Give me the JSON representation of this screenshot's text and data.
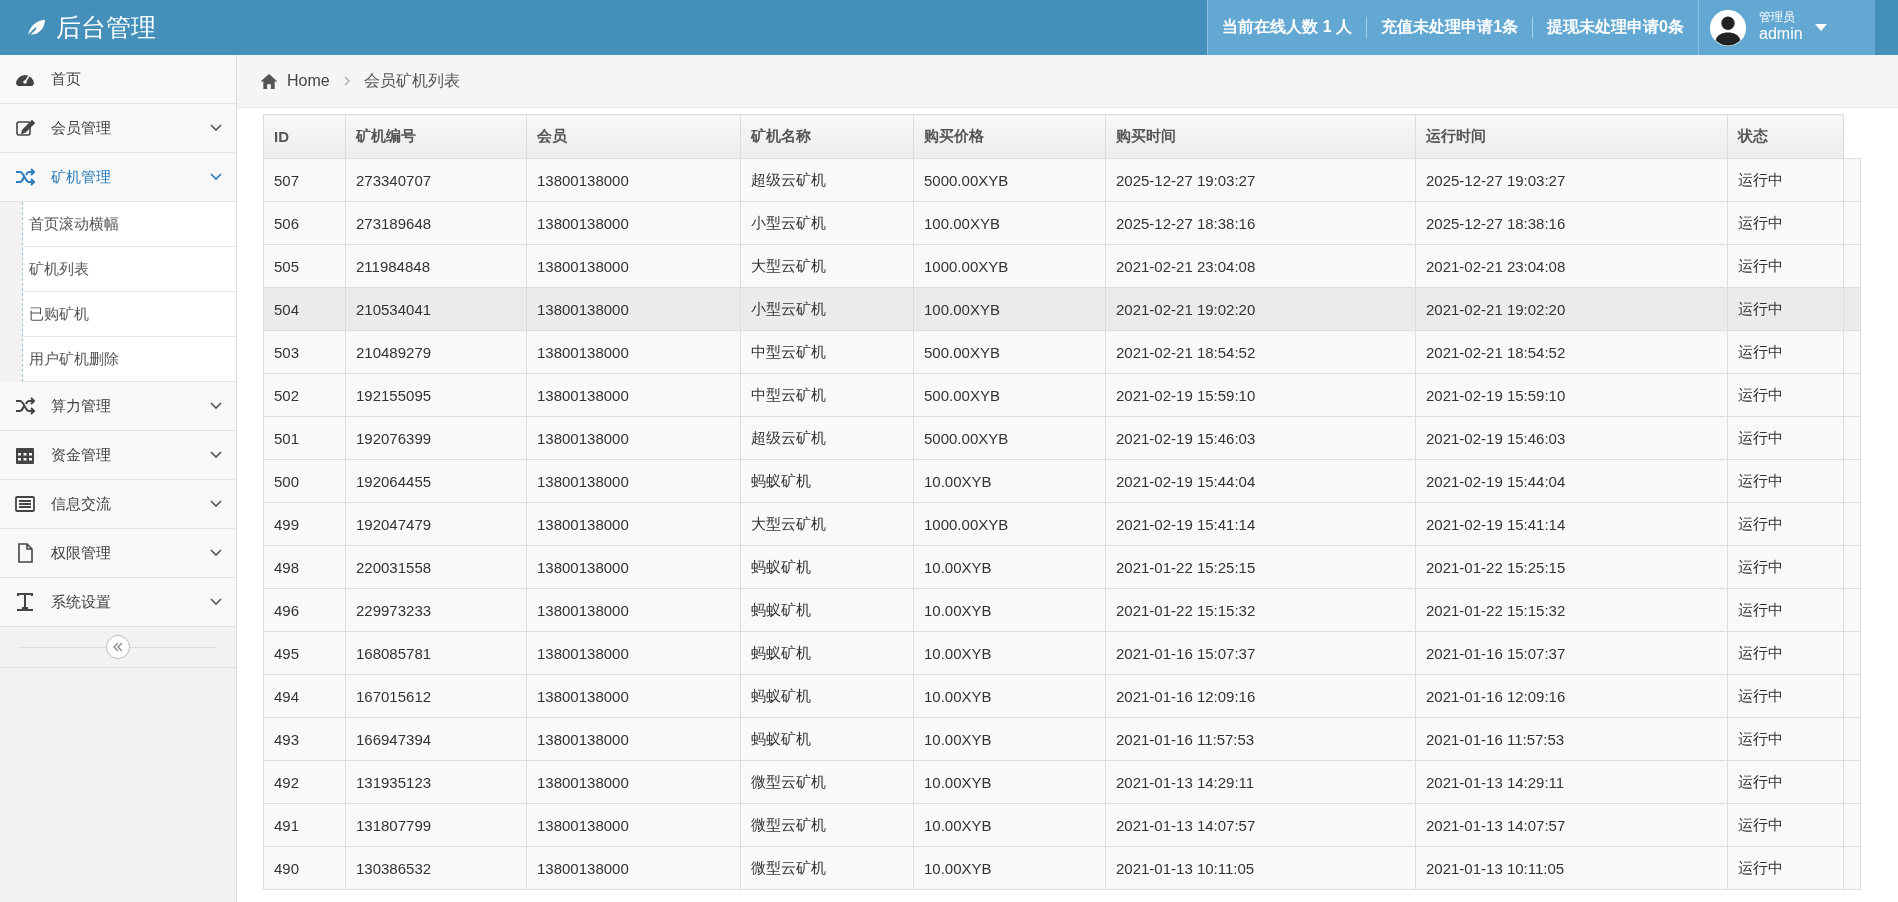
{
  "header": {
    "title": "后台管理",
    "stats": [
      "当前在线人数 1 人",
      "充值未处理申请1条",
      "提现未处理申请0条"
    ],
    "user": {
      "role": "管理员",
      "name": "admin"
    }
  },
  "sidebar": {
    "items": [
      {
        "label": "首页",
        "has_arrow": false,
        "selected": false
      },
      {
        "label": "会员管理",
        "has_arrow": true,
        "expanded": false,
        "selected": false
      },
      {
        "label": "矿机管理",
        "has_arrow": true,
        "expanded": true,
        "selected": true,
        "children": [
          {
            "label": "首页滚动横幅"
          },
          {
            "label": "矿机列表"
          },
          {
            "label": "已购矿机"
          },
          {
            "label": "用户矿机删除"
          }
        ]
      },
      {
        "label": "算力管理",
        "has_arrow": true,
        "expanded": false,
        "selected": false
      },
      {
        "label": "资金管理",
        "has_arrow": true,
        "expanded": false,
        "selected": false
      },
      {
        "label": "信息交流",
        "has_arrow": true,
        "expanded": false,
        "selected": false
      },
      {
        "label": "权限管理",
        "has_arrow": true,
        "expanded": false,
        "selected": false
      },
      {
        "label": "系统设置",
        "has_arrow": true,
        "expanded": false,
        "selected": false
      }
    ]
  },
  "breadcrumb": [
    "Home",
    "会员矿机列表"
  ],
  "table": {
    "columns": [
      "ID",
      "矿机编号",
      "会员",
      "矿机名称",
      "购买价格",
      "购买时间",
      "运行时间",
      "状态"
    ],
    "rows": [
      {
        "selected": false,
        "cells": [
          "507",
          "273340707",
          "13800138000",
          "超级云矿机",
          "5000.00XYB",
          "2025-12-27 19:03:27",
          "2025-12-27 19:03:27",
          "运行中"
        ]
      },
      {
        "selected": false,
        "cells": [
          "506",
          "273189648",
          "13800138000",
          "小型云矿机",
          "100.00XYB",
          "2025-12-27 18:38:16",
          "2025-12-27 18:38:16",
          "运行中"
        ]
      },
      {
        "selected": false,
        "cells": [
          "505",
          "211984848",
          "13800138000",
          "大型云矿机",
          "1000.00XYB",
          "2021-02-21 23:04:08",
          "2021-02-21 23:04:08",
          "运行中"
        ]
      },
      {
        "selected": true,
        "cells": [
          "504",
          "210534041",
          "13800138000",
          "小型云矿机",
          "100.00XYB",
          "2021-02-21 19:02:20",
          "2021-02-21 19:02:20",
          "运行中"
        ]
      },
      {
        "selected": false,
        "cells": [
          "503",
          "210489279",
          "13800138000",
          "中型云矿机",
          "500.00XYB",
          "2021-02-21 18:54:52",
          "2021-02-21 18:54:52",
          "运行中"
        ]
      },
      {
        "selected": false,
        "cells": [
          "502",
          "192155095",
          "13800138000",
          "中型云矿机",
          "500.00XYB",
          "2021-02-19 15:59:10",
          "2021-02-19 15:59:10",
          "运行中"
        ]
      },
      {
        "selected": false,
        "cells": [
          "501",
          "192076399",
          "13800138000",
          "超级云矿机",
          "5000.00XYB",
          "2021-02-19 15:46:03",
          "2021-02-19 15:46:03",
          "运行中"
        ]
      },
      {
        "selected": false,
        "cells": [
          "500",
          "192064455",
          "13800138000",
          "蚂蚁矿机",
          "10.00XYB",
          "2021-02-19 15:44:04",
          "2021-02-19 15:44:04",
          "运行中"
        ]
      },
      {
        "selected": false,
        "cells": [
          "499",
          "192047479",
          "13800138000",
          "大型云矿机",
          "1000.00XYB",
          "2021-02-19 15:41:14",
          "2021-02-19 15:41:14",
          "运行中"
        ]
      },
      {
        "selected": false,
        "cells": [
          "498",
          "220031558",
          "13800138000",
          "蚂蚁矿机",
          "10.00XYB",
          "2021-01-22 15:25:15",
          "2021-01-22 15:25:15",
          "运行中"
        ]
      },
      {
        "selected": false,
        "cells": [
          "496",
          "229973233",
          "13800138000",
          "蚂蚁矿机",
          "10.00XYB",
          "2021-01-22 15:15:32",
          "2021-01-22 15:15:32",
          "运行中"
        ]
      },
      {
        "selected": false,
        "cells": [
          "495",
          "168085781",
          "13800138000",
          "蚂蚁矿机",
          "10.00XYB",
          "2021-01-16 15:07:37",
          "2021-01-16 15:07:37",
          "运行中"
        ]
      },
      {
        "selected": false,
        "cells": [
          "494",
          "167015612",
          "13800138000",
          "蚂蚁矿机",
          "10.00XYB",
          "2021-01-16 12:09:16",
          "2021-01-16 12:09:16",
          "运行中"
        ]
      },
      {
        "selected": false,
        "cells": [
          "493",
          "166947394",
          "13800138000",
          "蚂蚁矿机",
          "10.00XYB",
          "2021-01-16 11:57:53",
          "2021-01-16 11:57:53",
          "运行中"
        ]
      },
      {
        "selected": false,
        "cells": [
          "492",
          "131935123",
          "13800138000",
          "微型云矿机",
          "10.00XYB",
          "2021-01-13 14:29:11",
          "2021-01-13 14:29:11",
          "运行中"
        ]
      },
      {
        "selected": false,
        "cells": [
          "491",
          "131807799",
          "13800138000",
          "微型云矿机",
          "10.00XYB",
          "2021-01-13 14:07:57",
          "2021-01-13 14:07:57",
          "运行中"
        ]
      },
      {
        "selected": false,
        "cells": [
          "490",
          "130386532",
          "13800138000",
          "微型云矿机",
          "10.00XYB",
          "2021-01-13 10:11:05",
          "2021-01-13 10:11:05",
          "运行中"
        ]
      }
    ]
  }
}
